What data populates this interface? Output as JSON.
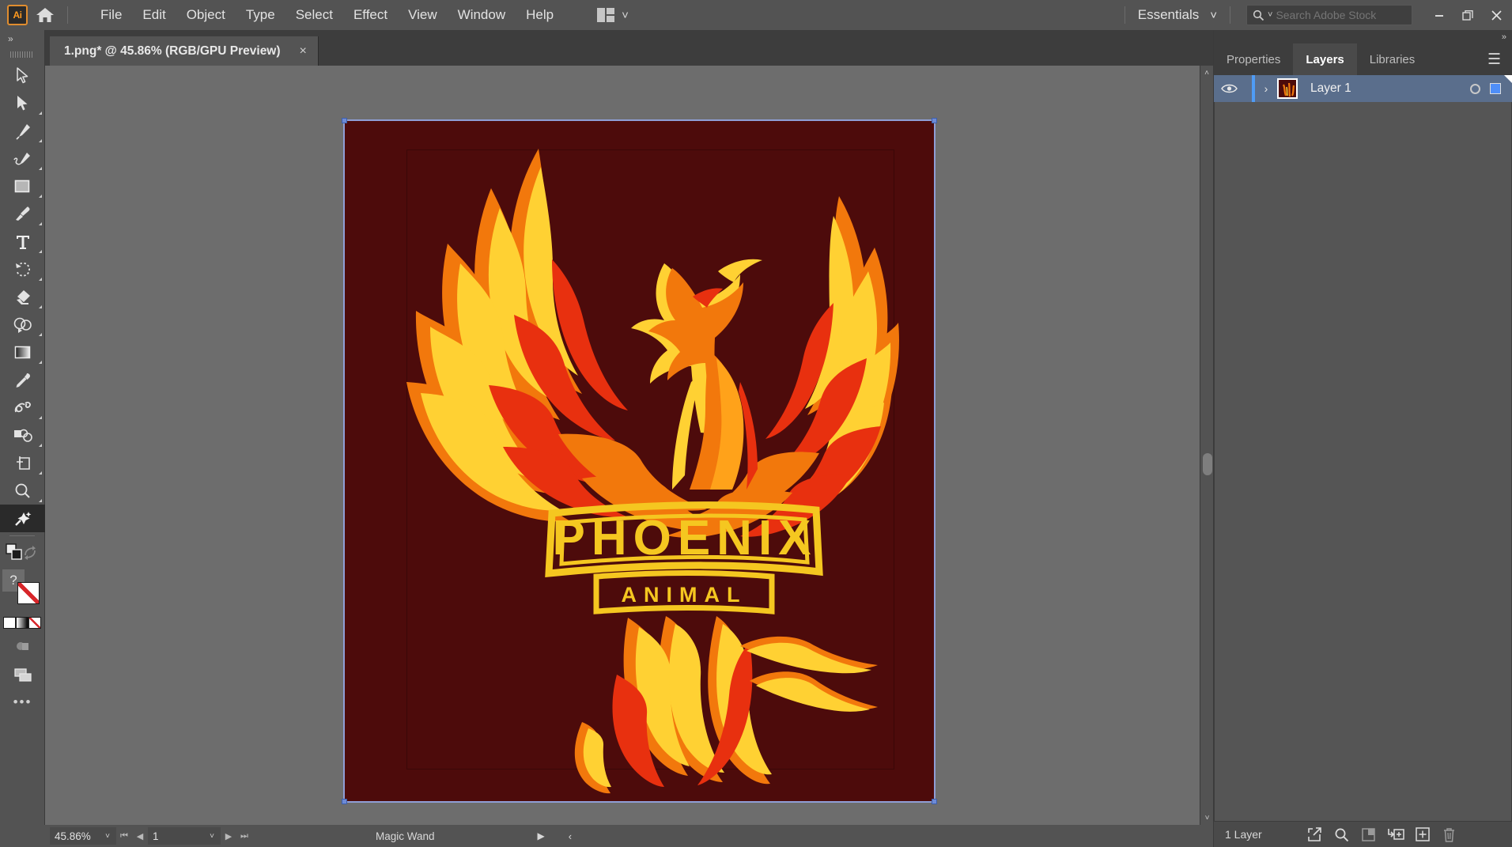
{
  "app": {
    "logo_text": "Ai",
    "home_icon": "home-icon"
  },
  "menubar": {
    "items": [
      "File",
      "Edit",
      "Object",
      "Type",
      "Select",
      "Effect",
      "View",
      "Window",
      "Help"
    ],
    "arrange_icon": "arrange-documents-icon",
    "arrange_caret": "˅",
    "workspace_label": "Essentials",
    "workspace_caret": "˅",
    "search_placeholder": "Search Adobe Stock",
    "search_value": "",
    "window_minimize": "minimize-icon",
    "window_restore": "restore-icon",
    "window_close": "close-icon"
  },
  "tabbar": {
    "document_title": "1.png* @ 45.86% (RGB/GPU Preview)",
    "close_label": "×"
  },
  "toolbar": {
    "collapse_label": "»",
    "tools": [
      {
        "name": "selection-tool",
        "icon": "arrow-cursor-icon",
        "active": false,
        "corner": false
      },
      {
        "name": "direct-selection-tool",
        "icon": "direct-select-icon",
        "active": false,
        "corner": true
      },
      {
        "name": "pen-tool",
        "icon": "pen-icon",
        "active": false,
        "corner": true
      },
      {
        "name": "curvature-tool",
        "icon": "curvature-icon",
        "active": false,
        "corner": true
      },
      {
        "name": "rectangle-tool",
        "icon": "rectangle-icon",
        "active": false,
        "corner": true
      },
      {
        "name": "paintbrush-tool",
        "icon": "paintbrush-icon",
        "active": false,
        "corner": true
      },
      {
        "name": "type-tool",
        "icon": "type-icon",
        "active": false,
        "corner": true
      },
      {
        "name": "rotate-tool",
        "icon": "rotate-icon",
        "active": false,
        "corner": true
      },
      {
        "name": "eraser-tool",
        "icon": "eraser-icon",
        "active": false,
        "corner": true
      },
      {
        "name": "shape-builder-tool",
        "icon": "shape-builder-icon",
        "active": false,
        "corner": true
      },
      {
        "name": "gradient-tool",
        "icon": "gradient-icon",
        "active": false,
        "corner": true
      },
      {
        "name": "eyedropper-tool",
        "icon": "eyedropper-icon",
        "active": false,
        "corner": true
      },
      {
        "name": "blend-tool",
        "icon": "blend-icon",
        "active": false,
        "corner": false
      },
      {
        "name": "symbol-sprayer-tool",
        "icon": "symbol-sprayer-icon",
        "active": false,
        "corner": true
      },
      {
        "name": "artboard-tool",
        "icon": "artboard-icon",
        "active": false,
        "corner": false
      },
      {
        "name": "zoom-tool",
        "icon": "magnifier-icon",
        "active": false,
        "corner": true
      },
      {
        "name": "magic-wand-tool",
        "icon": "magic-wand-icon",
        "active": true,
        "corner": false
      }
    ],
    "drawing_mode_icon": "drawing-modes-icon",
    "change_shape_icon": "change-screen-icon",
    "fill_stroke": {
      "question_label": "?",
      "fill_color": "#ffffff",
      "stroke_color": "#ffffff",
      "none_marker": "#d7262a"
    },
    "more_tools_label": "•••"
  },
  "canvas": {
    "artwork_title": "PHOENIX",
    "artwork_subtitle": "ANIMAL",
    "background_color": "#4d0b0b",
    "gold_color": "#f5c720",
    "orange_color": "#f97b0c",
    "yellow_color": "#ffd93b",
    "red_color": "#e8270e",
    "selection_color": "#8f9ed6"
  },
  "statusbar": {
    "zoom_value": "45.86%",
    "zoom_caret": "˅",
    "first_page_icon": "first-page-icon",
    "prev_page_icon": "prev-page-icon",
    "page_value": "1",
    "page_caret": "˅",
    "next_page_icon": "next-page-icon",
    "last_page_icon": "last-page-icon",
    "current_tool": "Magic Wand",
    "tool_caret": "▶",
    "left_caret": "‹"
  },
  "rightpanel": {
    "collapse_label": "»",
    "tabs": [
      {
        "label": "Properties",
        "active": false
      },
      {
        "label": "Layers",
        "active": true
      },
      {
        "label": "Libraries",
        "active": false
      }
    ],
    "menu_icon": "hamburger-menu-icon",
    "layers": [
      {
        "visibility_icon": "eye-icon",
        "expand_icon": "chevron-right-icon",
        "thumbnail": "layer-thumbnail",
        "name": "Layer 1",
        "target_icon": "target-circle-icon",
        "selected_swatch": "#4f8ef7"
      }
    ],
    "footer": {
      "count_label": "1 Layer",
      "icons": [
        "locate-object-icon",
        "search-icon",
        "make-clipping-mask-icon",
        "create-sublayer-icon",
        "create-new-layer-icon",
        "delete-layer-icon"
      ]
    }
  }
}
